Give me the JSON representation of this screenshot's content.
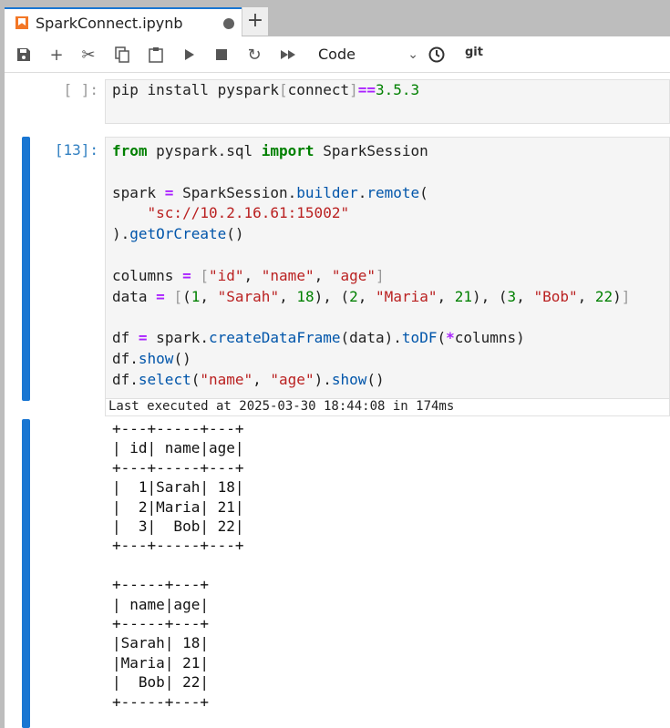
{
  "tab": {
    "title": "SparkConnect.ipynb",
    "add_label": "+"
  },
  "toolbar": {
    "cell_type": "Code",
    "git_label": "git"
  },
  "cells": [
    {
      "prompt": "[ ]:",
      "lines": [
        [
          [
            "t",
            "pip install pyspark"
          ],
          [
            "br",
            "["
          ],
          [
            "t",
            "connect"
          ],
          [
            "br",
            "]"
          ],
          [
            "op",
            "=="
          ],
          [
            "num",
            "3.5.3"
          ]
        ]
      ]
    },
    {
      "prompt": "[13]:",
      "lines": [
        [
          [
            "kw",
            "from"
          ],
          [
            "t",
            " pyspark.sql "
          ],
          [
            "kw",
            "import"
          ],
          [
            "t",
            " SparkSession"
          ]
        ],
        [],
        [
          [
            "t",
            "spark "
          ],
          [
            "op",
            "="
          ],
          [
            "t",
            " SparkSession."
          ],
          [
            "fn",
            "builder"
          ],
          [
            "t",
            "."
          ],
          [
            "fn",
            "remote"
          ],
          [
            "t",
            "("
          ]
        ],
        [
          [
            "t",
            "    "
          ],
          [
            "str",
            "\"sc://10.2.16.61:15002\""
          ]
        ],
        [
          [
            "t",
            ")."
          ],
          [
            "fn",
            "getOrCreate"
          ],
          [
            "t",
            "()"
          ]
        ],
        [],
        [
          [
            "t",
            "columns "
          ],
          [
            "op",
            "="
          ],
          [
            "t",
            " "
          ],
          [
            "br",
            "["
          ],
          [
            "str",
            "\"id\""
          ],
          [
            "t",
            ", "
          ],
          [
            "str",
            "\"name\""
          ],
          [
            "t",
            ", "
          ],
          [
            "str",
            "\"age\""
          ],
          [
            "br",
            "]"
          ]
        ],
        [
          [
            "t",
            "data "
          ],
          [
            "op",
            "="
          ],
          [
            "t",
            " "
          ],
          [
            "br",
            "["
          ],
          [
            "t",
            "("
          ],
          [
            "num",
            "1"
          ],
          [
            "t",
            ", "
          ],
          [
            "str",
            "\"Sarah\""
          ],
          [
            "t",
            ", "
          ],
          [
            "num",
            "18"
          ],
          [
            "t",
            "), ("
          ],
          [
            "num",
            "2"
          ],
          [
            "t",
            ", "
          ],
          [
            "str",
            "\"Maria\""
          ],
          [
            "t",
            ", "
          ],
          [
            "num",
            "21"
          ],
          [
            "t",
            "), ("
          ],
          [
            "num",
            "3"
          ],
          [
            "t",
            ", "
          ],
          [
            "str",
            "\"Bob\""
          ],
          [
            "t",
            ", "
          ],
          [
            "num",
            "22"
          ],
          [
            "t",
            ")"
          ],
          [
            "br",
            "]"
          ]
        ],
        [],
        [
          [
            "t",
            "df "
          ],
          [
            "op",
            "="
          ],
          [
            "t",
            " spark."
          ],
          [
            "fn",
            "createDataFrame"
          ],
          [
            "t",
            "(data)."
          ],
          [
            "fn",
            "toDF"
          ],
          [
            "t",
            "("
          ],
          [
            "op",
            "*"
          ],
          [
            "t",
            "columns)"
          ]
        ],
        [
          [
            "t",
            "df."
          ],
          [
            "fn",
            "show"
          ],
          [
            "t",
            "()"
          ]
        ],
        [
          [
            "t",
            "df."
          ],
          [
            "fn",
            "select"
          ],
          [
            "t",
            "("
          ],
          [
            "str",
            "\"name\""
          ],
          [
            "t",
            ", "
          ],
          [
            "str",
            "\"age\""
          ],
          [
            "t",
            ")."
          ],
          [
            "fn",
            "show"
          ],
          [
            "t",
            "()"
          ]
        ]
      ],
      "status": "Last executed at 2025-03-30 18:44:08 in 174ms",
      "output": "+---+-----+---+\n| id| name|age|\n+---+-----+---+\n|  1|Sarah| 18|\n|  2|Maria| 21|\n|  3|  Bob| 22|\n+---+-----+---+\n\n+-----+---+\n| name|age|\n+-----+---+\n|Sarah| 18|\n|Maria| 21|\n|  Bob| 22|\n+-----+---+"
    }
  ]
}
